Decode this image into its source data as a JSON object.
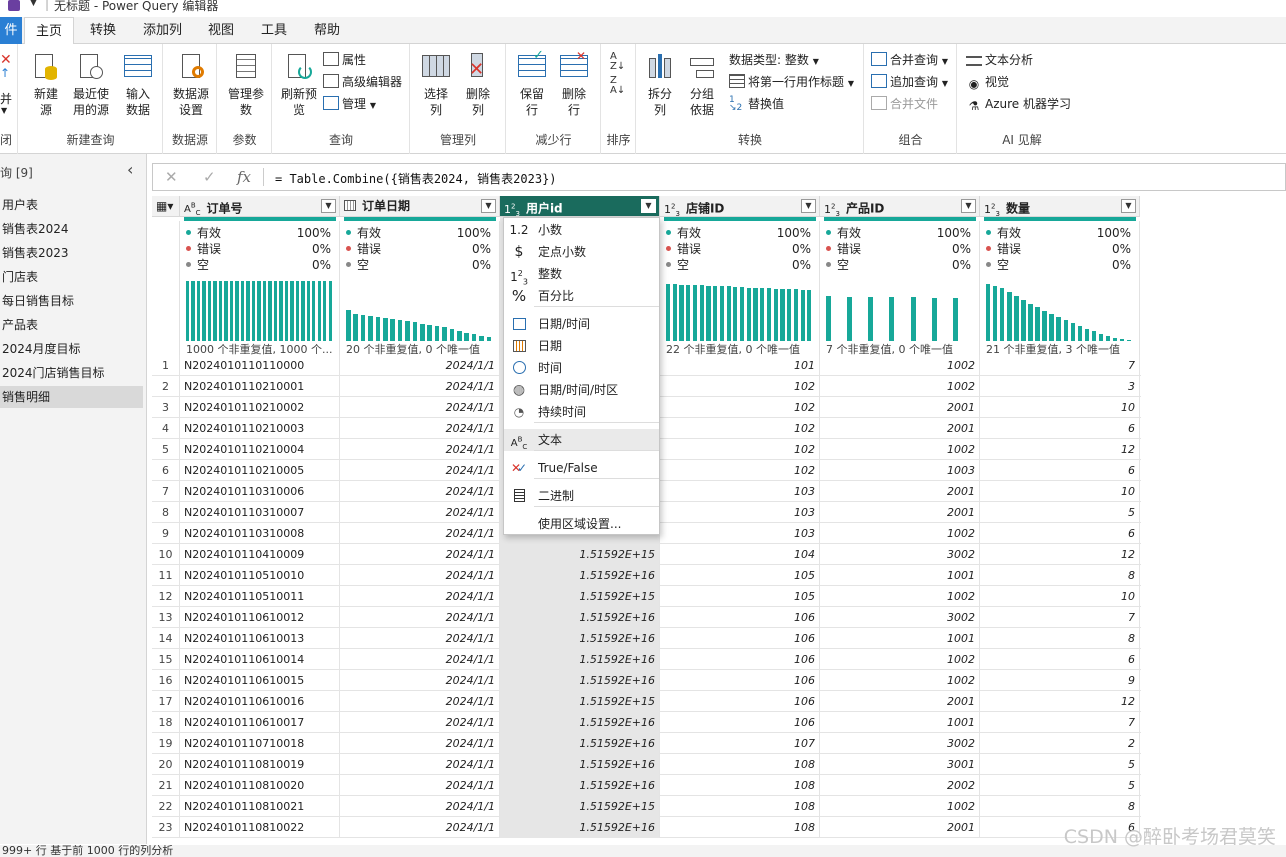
{
  "window": {
    "title": "无标题 - Power Query 编辑器"
  },
  "tabs": {
    "file": "件",
    "home": "主页",
    "transform": "转换",
    "add_column": "添加列",
    "view": "视图",
    "tools": "工具",
    "help": "帮助"
  },
  "ribbon": {
    "close_apply": "并",
    "close_group_label": "闭",
    "new_source": "新建源",
    "recent_sources": "最近使用的源",
    "enter_data": "输入数据",
    "new_query_group": "新建查询",
    "data_source_settings": "数据源设置",
    "data_source_group": "数据源",
    "manage_params": "管理参数",
    "params_group": "参数",
    "refresh_preview": "刷新预览",
    "properties": "属性",
    "advanced_editor": "高级编辑器",
    "manage": "管理",
    "query_group": "查询",
    "choose_columns": "选择列",
    "remove_columns": "删除列",
    "manage_columns_group": "管理列",
    "keep_rows": "保留行",
    "remove_rows": "删除行",
    "reduce_rows_group": "减少行",
    "sort_group": "排序",
    "split_column": "拆分列",
    "group_by": "分组依据",
    "data_type": "数据类型: 整数",
    "first_row_header": "将第一行用作标题",
    "replace_values": "替换值",
    "transform_group": "转换",
    "merge_queries": "合并查询",
    "append_queries": "追加查询",
    "combine_files": "合并文件",
    "combine_group": "组合",
    "text_analytics": "文本分析",
    "vision": "视觉",
    "azure_ml": "Azure 机器学习",
    "ai_group": "AI 见解"
  },
  "queries": {
    "header": "询 [9]",
    "items": [
      "用户表",
      "销售表2024",
      "销售表2023",
      "门店表",
      "每日销售目标",
      "产品表",
      "2024月度目标",
      "2024门店销售目标",
      "销售明细"
    ]
  },
  "formula": {
    "fx": "fx",
    "text": "= Table.Combine({销售表2024, 销售表2023})"
  },
  "columns": [
    {
      "name": "订单号",
      "type": "ABC",
      "valid": "100%",
      "error": "0%",
      "empty": "0%",
      "footer": "1000 个非重复值, 1000 个..."
    },
    {
      "name": "订单日期",
      "type": "date",
      "valid": "100%",
      "error": "0%",
      "empty": "0%",
      "footer": "20 个非重复值, 0 个唯一值"
    },
    {
      "name": "用户id",
      "type": "123",
      "valid": "",
      "error": "",
      "empty": "",
      "footer": ""
    },
    {
      "name": "店铺ID",
      "type": "123",
      "valid": "100%",
      "error": "0%",
      "empty": "0%",
      "footer": "22 个非重复值, 0 个唯一值"
    },
    {
      "name": "产品ID",
      "type": "123",
      "valid": "100%",
      "error": "0%",
      "empty": "0%",
      "footer": "7 个非重复值, 0 个唯一值"
    },
    {
      "name": "数量",
      "type": "123",
      "valid": "100%",
      "error": "0%",
      "empty": "0%",
      "footer": "21 个非重复值, 3 个唯一值"
    }
  ],
  "profile_labels": {
    "valid": "有效",
    "error": "错误",
    "empty": "空"
  },
  "histograms": {
    "orders": [
      1,
      1,
      1,
      1,
      1,
      1,
      1,
      1,
      1,
      1,
      1,
      1,
      1,
      1,
      1,
      1,
      1,
      1,
      1,
      1,
      1,
      1,
      1,
      1,
      1,
      1,
      1
    ],
    "dates": [
      0.52,
      0.45,
      0.43,
      0.42,
      0.4,
      0.39,
      0.37,
      0.35,
      0.33,
      0.31,
      0.29,
      0.27,
      0.25,
      0.23,
      0.2,
      0.17,
      0.14,
      0.12,
      0.09,
      0.06
    ],
    "stores": [
      0.95,
      0.95,
      0.94,
      0.94,
      0.93,
      0.93,
      0.92,
      0.92,
      0.91,
      0.91,
      0.9,
      0.9,
      0.89,
      0.89,
      0.88,
      0.88,
      0.87,
      0.87,
      0.86,
      0.86,
      0.85,
      0.85
    ],
    "products": [
      0.75,
      0.74,
      0.74,
      0.73,
      0.73,
      0.72,
      0.72
    ],
    "quantity": [
      0.95,
      0.92,
      0.88,
      0.82,
      0.75,
      0.68,
      0.62,
      0.56,
      0.5,
      0.45,
      0.4,
      0.35,
      0.3,
      0.25,
      0.2,
      0.16,
      0.12,
      0.08,
      0.05,
      0.03,
      0.02
    ]
  },
  "rows": [
    [
      "1",
      "N2024010110110000",
      "2024/1/1",
      "",
      "101",
      "1002",
      "7"
    ],
    [
      "2",
      "N2024010110210001",
      "2024/1/1",
      "",
      "102",
      "1002",
      "3"
    ],
    [
      "3",
      "N2024010110210002",
      "2024/1/1",
      "",
      "102",
      "2001",
      "10"
    ],
    [
      "4",
      "N2024010110210003",
      "2024/1/1",
      "",
      "102",
      "2001",
      "6"
    ],
    [
      "5",
      "N2024010110210004",
      "2024/1/1",
      "",
      "102",
      "1002",
      "12"
    ],
    [
      "6",
      "N2024010110210005",
      "2024/1/1",
      "",
      "102",
      "1003",
      "6"
    ],
    [
      "7",
      "N2024010110310006",
      "2024/1/1",
      "",
      "103",
      "2001",
      "10"
    ],
    [
      "8",
      "N2024010110310007",
      "2024/1/1",
      "",
      "103",
      "2001",
      "5"
    ],
    [
      "9",
      "N2024010110310008",
      "2024/1/1",
      "",
      "103",
      "1002",
      "6"
    ],
    [
      "10",
      "N2024010110410009",
      "2024/1/1",
      "1.51592E+15",
      "104",
      "3002",
      "12"
    ],
    [
      "11",
      "N2024010110510010",
      "2024/1/1",
      "1.51592E+16",
      "105",
      "1001",
      "8"
    ],
    [
      "12",
      "N2024010110510011",
      "2024/1/1",
      "1.51592E+15",
      "105",
      "1002",
      "10"
    ],
    [
      "13",
      "N2024010110610012",
      "2024/1/1",
      "1.51592E+16",
      "106",
      "3002",
      "7"
    ],
    [
      "14",
      "N2024010110610013",
      "2024/1/1",
      "1.51592E+16",
      "106",
      "1001",
      "8"
    ],
    [
      "15",
      "N2024010110610014",
      "2024/1/1",
      "1.51592E+16",
      "106",
      "1002",
      "6"
    ],
    [
      "16",
      "N2024010110610015",
      "2024/1/1",
      "1.51592E+16",
      "106",
      "1002",
      "9"
    ],
    [
      "17",
      "N2024010110610016",
      "2024/1/1",
      "1.51592E+15",
      "106",
      "2001",
      "12"
    ],
    [
      "18",
      "N2024010110610017",
      "2024/1/1",
      "1.51592E+16",
      "106",
      "1001",
      "7"
    ],
    [
      "19",
      "N2024010110710018",
      "2024/1/1",
      "1.51592E+16",
      "107",
      "3002",
      "2"
    ],
    [
      "20",
      "N2024010110810019",
      "2024/1/1",
      "1.51592E+16",
      "108",
      "3001",
      "5"
    ],
    [
      "21",
      "N2024010110810020",
      "2024/1/1",
      "1.51592E+16",
      "108",
      "2002",
      "5"
    ],
    [
      "22",
      "N2024010110810021",
      "2024/1/1",
      "1.51592E+15",
      "108",
      "1002",
      "8"
    ],
    [
      "23",
      "N2024010110810022",
      "2024/1/1",
      "1.51592E+16",
      "108",
      "2001",
      "6"
    ]
  ],
  "type_menu": [
    {
      "icon": "1.2",
      "label": "小数"
    },
    {
      "icon": "$",
      "label": "定点小数"
    },
    {
      "icon": "123",
      "label": "整数"
    },
    {
      "icon": "%",
      "label": "百分比"
    },
    {
      "icon": "datetime",
      "label": "日期/时间"
    },
    {
      "icon": "date",
      "label": "日期"
    },
    {
      "icon": "clock",
      "label": "时间"
    },
    {
      "icon": "globe",
      "label": "日期/时间/时区"
    },
    {
      "icon": "stopwatch",
      "label": "持续时间"
    },
    {
      "icon": "ABC",
      "label": "文本"
    },
    {
      "icon": "truefalse",
      "label": "True/False"
    },
    {
      "icon": "binary",
      "label": "二进制"
    },
    {
      "icon": "",
      "label": "使用区域设置..."
    }
  ],
  "status": {
    "text": "999+ 行    基于前 1000 行的列分析"
  },
  "watermark": "CSDN @醉卧考场君莫笑",
  "colors": {
    "accent": "#17a899",
    "selected_header": "#1a6b5d",
    "file_tab": "#2a7fd4",
    "error_dot": "#d9534f"
  }
}
